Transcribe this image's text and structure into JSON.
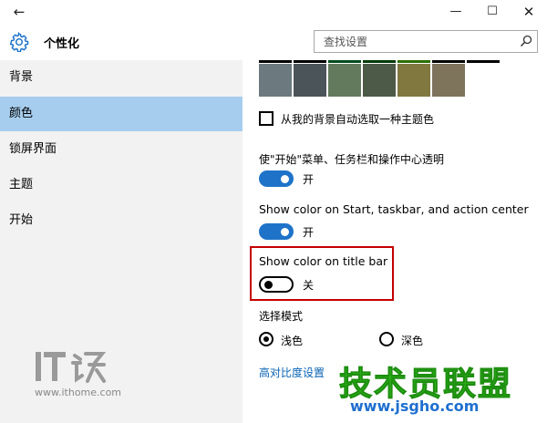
{
  "window": {
    "back_glyph": "←",
    "minimize_glyph": "—",
    "maximize_glyph": "☐",
    "close_glyph": "✕"
  },
  "header": {
    "title": "个性化",
    "search_placeholder": "查找设置",
    "icon": "gear-icon",
    "search_icon": "search-icon"
  },
  "sidebar": {
    "items": [
      {
        "label": "背景",
        "active": false
      },
      {
        "label": "颜色",
        "active": true
      },
      {
        "label": "锁屏界面",
        "active": false
      },
      {
        "label": "主题",
        "active": false
      },
      {
        "label": "开始",
        "active": false
      }
    ]
  },
  "watermarks": {
    "ithome_logo": "IT之家",
    "ithome_url": "www.ithome.com",
    "brand_text": "技术员联盟",
    "brand_url": "www.jsgho.com"
  },
  "colors": {
    "accent": "#1e73c9",
    "nav_active": "#a6cdee",
    "sidebar_bg": "#f2f2f2",
    "highlight": "#c40000",
    "link": "#0a63b5",
    "swatches": [
      "#6c7a7f",
      "#4b5459",
      "#637b5c",
      "#4c5a47",
      "#817840",
      "#7e745c"
    ],
    "swatch_top_lines": [
      "#000000",
      "#000000",
      "#004a1c",
      "#003a05",
      "#2d6f00",
      "#000000",
      "#000000"
    ]
  },
  "content": {
    "auto_pick_checkbox": {
      "label": "从我的背景自动选取一种主题色",
      "checked": false
    },
    "transparency": {
      "label": "使\"开始\"菜单、任务栏和操作中心透明",
      "state": "开",
      "on": true
    },
    "show_color_start": {
      "label": "Show color on Start, taskbar, and action center",
      "state": "开",
      "on": true
    },
    "show_color_title": {
      "label": "Show color on title bar",
      "state": "关",
      "on": false
    },
    "mode": {
      "label": "选择模式",
      "options": [
        {
          "label": "浅色",
          "checked": true
        },
        {
          "label": "深色",
          "checked": false
        }
      ]
    },
    "high_contrast_link": "高对比度设置"
  }
}
